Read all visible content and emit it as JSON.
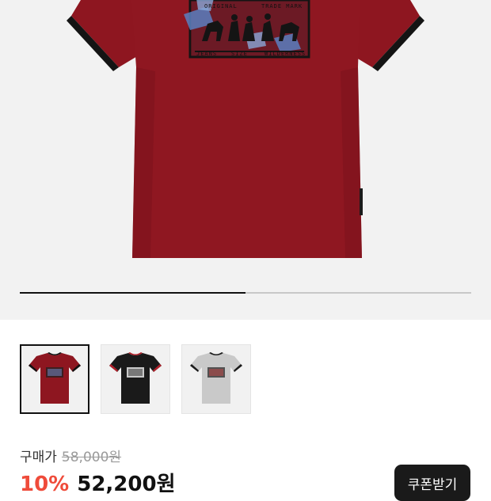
{
  "gallery": {
    "progress": 0.5,
    "thumbnails": [
      {
        "name": "red",
        "body_color": "#8e1620",
        "trim_color": "#111111",
        "selected": true
      },
      {
        "name": "black",
        "body_color": "#1a1a1a",
        "trim_color": "#b0202a",
        "selected": false
      },
      {
        "name": "gray",
        "body_color": "#c9c9c9",
        "trim_color": "#1a1a1a",
        "selected": false
      }
    ]
  },
  "graphic_text": {
    "top_left": "ORIGINAL",
    "top_right": "TRADE MARK",
    "bottom_left": "JEANS",
    "bottom_mid": "SIZE",
    "bottom_right": "WILDERNESS"
  },
  "pricing": {
    "label": "구매가",
    "original_price": "58,000원",
    "discount": "10%",
    "sale_price": "52,200원"
  },
  "actions": {
    "coupon_label": "쿠폰받기"
  },
  "colors": {
    "accent": "#ef4b3a",
    "hero_bg": "#f2f2f2",
    "shirt_red": "#8e1620"
  }
}
